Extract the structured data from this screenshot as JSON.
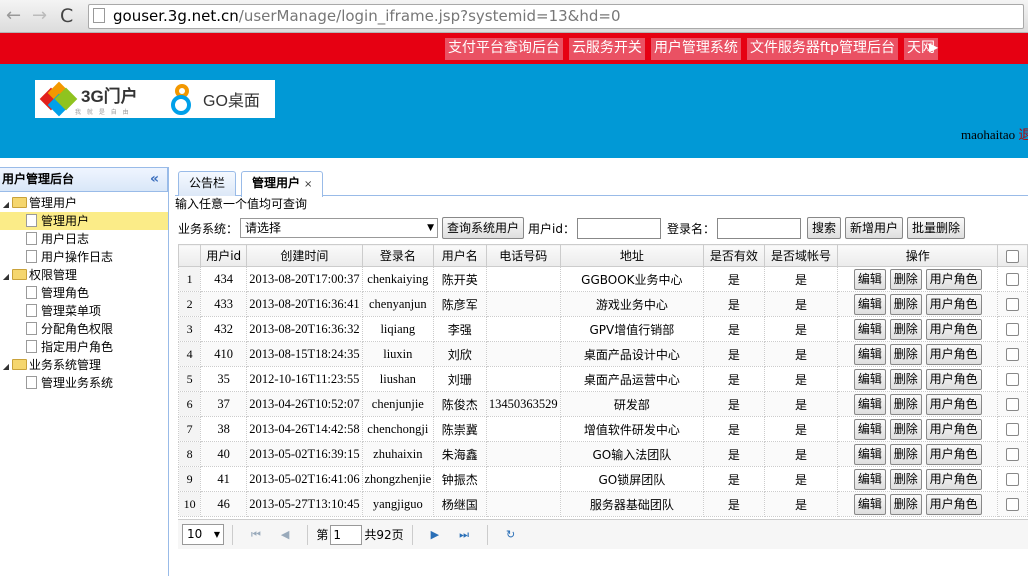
{
  "browser": {
    "url_host": "gouser.3g.net.cn",
    "url_path": "/userManage/login_iframe.jsp?systemid=13&hd=0"
  },
  "topnav": {
    "links": [
      "支付平台查询后台",
      "云服务开关",
      "用户管理系统",
      "文件服务器ftp管理后台",
      "天网"
    ],
    "more": "▶"
  },
  "banner": {
    "logo_3g": "3G门户",
    "logo_3g_sub": "我 就 是 自 由",
    "logo_go": "GO桌面",
    "username": "maohaitao",
    "user_more": "退"
  },
  "sidebar": {
    "title": "用户管理后台",
    "collapse": "«",
    "groups": [
      {
        "label": "管理用户",
        "items": [
          "管理用户",
          "用户日志",
          "用户操作日志"
        ]
      },
      {
        "label": "权限管理",
        "items": [
          "管理角色",
          "管理菜单项",
          "分配角色权限",
          "指定用户角色"
        ]
      },
      {
        "label": "业务系统管理",
        "items": [
          "管理业务系统"
        ]
      }
    ]
  },
  "tabs": {
    "notice": "公告栏",
    "manage": "管理用户",
    "close": "×"
  },
  "hint": "输入任意一个值均可查询",
  "toolbar": {
    "system_label": "业务系统：",
    "system_value": "请选择",
    "query_system_btn": "查询系统用户",
    "userid_label": "用户id：",
    "login_label": "登录名：",
    "search_btn": "搜索",
    "add_btn": "新增用户",
    "batch_delete_btn": "批量删除"
  },
  "table": {
    "columns": [
      "用户id",
      "创建时间",
      "登录名",
      "用户名",
      "电话号码",
      "地址",
      "是否有效",
      "是否域帐号",
      "操作"
    ],
    "action_edit": "编辑",
    "action_delete": "删除",
    "action_role": "用户角色",
    "rows": [
      {
        "n": "1",
        "id": "434",
        "time": "2013-08-20T17:00:37",
        "login": "chenkaiying",
        "name": "陈开英",
        "phone": "",
        "addr": "GGBOOK业务中心",
        "valid": "是",
        "domain": "是"
      },
      {
        "n": "2",
        "id": "433",
        "time": "2013-08-20T16:36:41",
        "login": "chenyanjun",
        "name": "陈彦军",
        "phone": "",
        "addr": "游戏业务中心",
        "valid": "是",
        "domain": "是"
      },
      {
        "n": "3",
        "id": "432",
        "time": "2013-08-20T16:36:32",
        "login": "liqiang",
        "name": "李强",
        "phone": "",
        "addr": "GPV增值行销部",
        "valid": "是",
        "domain": "是"
      },
      {
        "n": "4",
        "id": "410",
        "time": "2013-08-15T18:24:35",
        "login": "liuxin",
        "name": "刘欣",
        "phone": "",
        "addr": "桌面产品设计中心",
        "valid": "是",
        "domain": "是"
      },
      {
        "n": "5",
        "id": "35",
        "time": "2012-10-16T11:23:55",
        "login": "liushan",
        "name": "刘珊",
        "phone": "",
        "addr": "桌面产品运营中心",
        "valid": "是",
        "domain": "是"
      },
      {
        "n": "6",
        "id": "37",
        "time": "2013-04-26T10:52:07",
        "login": "chenjunjie",
        "name": "陈俊杰",
        "phone": "13450363529",
        "addr": "研发部",
        "valid": "是",
        "domain": "是"
      },
      {
        "n": "7",
        "id": "38",
        "time": "2013-04-26T14:42:58",
        "login": "chenchongji",
        "name": "陈崇冀",
        "phone": "",
        "addr": "增值软件研发中心",
        "valid": "是",
        "domain": "是"
      },
      {
        "n": "8",
        "id": "40",
        "time": "2013-05-02T16:39:15",
        "login": "zhuhaixin",
        "name": "朱海鑫",
        "phone": "",
        "addr": "GO输入法团队",
        "valid": "是",
        "domain": "是"
      },
      {
        "n": "9",
        "id": "41",
        "time": "2013-05-02T16:41:06",
        "login": "zhongzhenjie",
        "name": "钟振杰",
        "phone": "",
        "addr": "GO锁屏团队",
        "valid": "是",
        "domain": "是"
      },
      {
        "n": "10",
        "id": "46",
        "time": "2013-05-27T13:10:45",
        "login": "yangjiguo",
        "name": "杨继国",
        "phone": "",
        "addr": "服务器基础团队",
        "valid": "是",
        "domain": "是"
      }
    ]
  },
  "pager": {
    "page_size": "10",
    "page_prefix": "第",
    "page_value": "1",
    "page_total": "共92页"
  }
}
